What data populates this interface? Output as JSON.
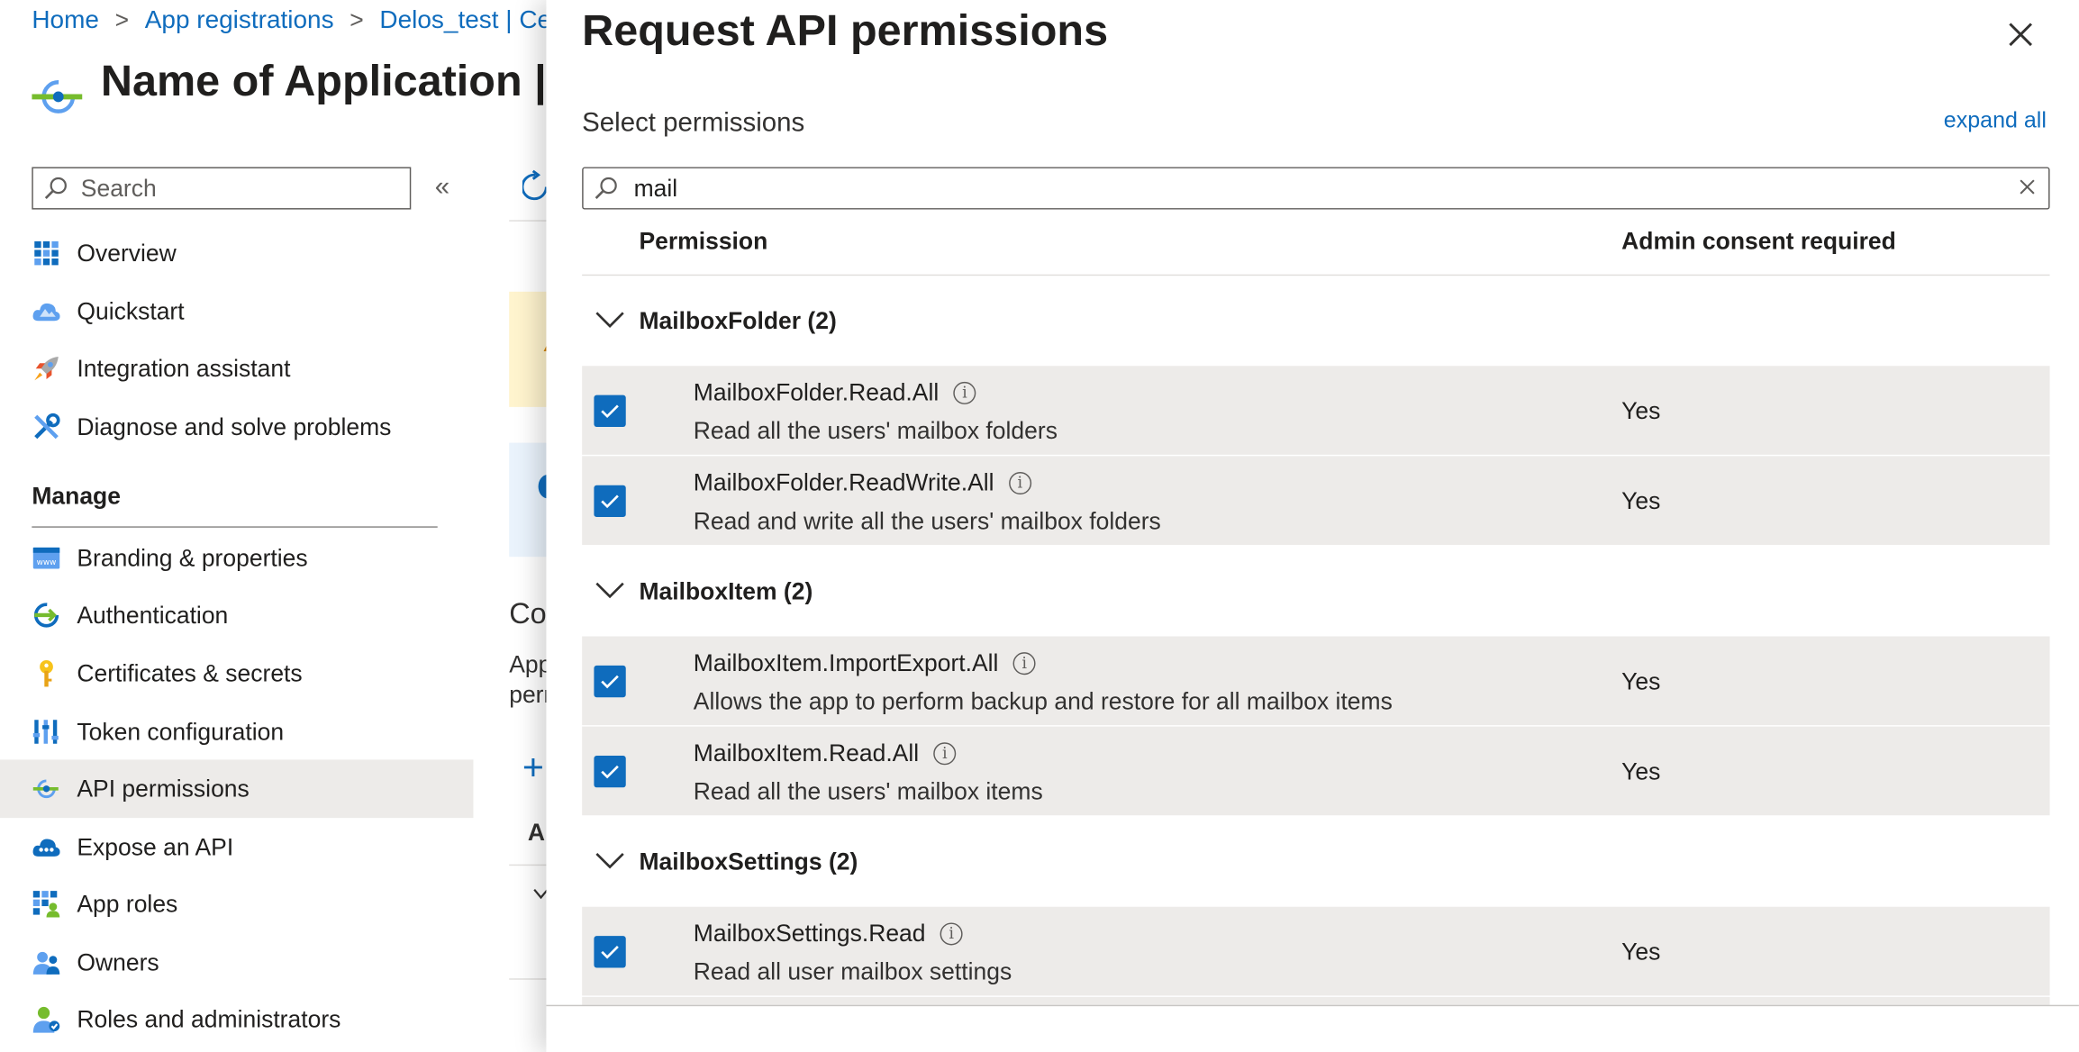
{
  "breadcrumb": {
    "home": "Home",
    "app_registrations": "App registrations",
    "current": "Delos_test | Cert"
  },
  "app": {
    "title": "Name of Application | A"
  },
  "sidebar": {
    "search_placeholder": "Search",
    "collapse_glyph": "«",
    "top_items": [
      {
        "label": "Overview",
        "icon": "overview-grid-icon"
      },
      {
        "label": "Quickstart",
        "icon": "cloud-quickstart-icon"
      },
      {
        "label": "Integration assistant",
        "icon": "rocket-icon"
      },
      {
        "label": "Diagnose and solve problems",
        "icon": "wrench-icon"
      }
    ],
    "manage_heading": "Manage",
    "manage_items": [
      {
        "label": "Branding & properties",
        "icon": "www-branding-icon"
      },
      {
        "label": "Authentication",
        "icon": "authentication-icon"
      },
      {
        "label": "Certificates & secrets",
        "icon": "key-icon"
      },
      {
        "label": "Token configuration",
        "icon": "token-bars-icon"
      },
      {
        "label": "API permissions",
        "icon": "api-permissions-icon",
        "active": true
      },
      {
        "label": "Expose an API",
        "icon": "cloud-api-icon"
      },
      {
        "label": "App roles",
        "icon": "app-roles-icon"
      },
      {
        "label": "Owners",
        "icon": "owners-icon"
      },
      {
        "label": "Roles and administrators",
        "icon": "roles-admin-icon"
      }
    ]
  },
  "middle": {
    "section_fragment": "Co",
    "text_fragment_1": "App",
    "text_fragment_2": "pern",
    "add_glyph": "+",
    "column_fragment": "Al"
  },
  "panel": {
    "title": "Request API permissions",
    "subheading": "Select permissions",
    "expand_all": "expand all",
    "filter_value": "mail",
    "col_permission": "Permission",
    "col_admin_consent": "Admin consent required",
    "groups": [
      {
        "label": "MailboxFolder (2)",
        "items": [
          {
            "name": "MailboxFolder.Read.All",
            "desc": "Read all the users' mailbox folders",
            "consent": "Yes",
            "checked": true
          },
          {
            "name": "MailboxFolder.ReadWrite.All",
            "desc": "Read and write all the users' mailbox folders",
            "consent": "Yes",
            "checked": true
          }
        ]
      },
      {
        "label": "MailboxItem (2)",
        "items": [
          {
            "name": "MailboxItem.ImportExport.All",
            "desc": "Allows the app to perform backup and restore for all mailbox items",
            "consent": "Yes",
            "checked": true
          },
          {
            "name": "MailboxItem.Read.All",
            "desc": "Read all the users' mailbox items",
            "consent": "Yes",
            "checked": true
          }
        ]
      },
      {
        "label": "MailboxSettings (2)",
        "items": [
          {
            "name": "MailboxSettings.Read",
            "desc": "Read all user mailbox settings",
            "consent": "Yes",
            "checked": true
          }
        ]
      }
    ],
    "info_glyph": "i"
  },
  "colors": {
    "accent": "#0f6cbd",
    "row_bg": "#edebe9",
    "text": "#201f1e"
  }
}
